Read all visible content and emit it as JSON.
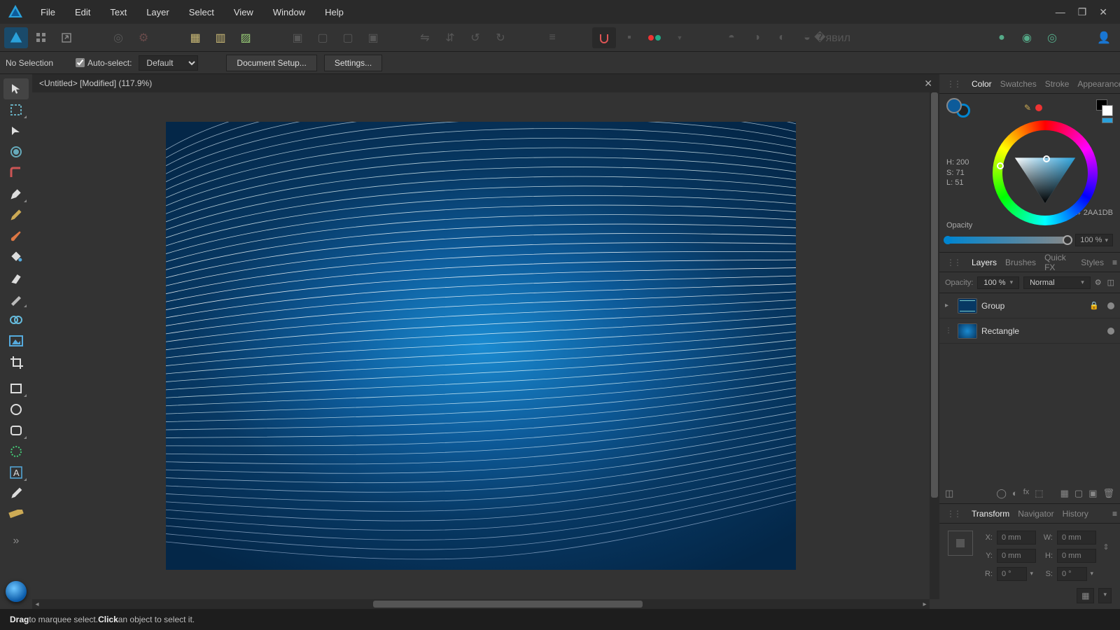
{
  "menu": {
    "items": [
      "File",
      "Edit",
      "Text",
      "Layer",
      "Select",
      "View",
      "Window",
      "Help"
    ]
  },
  "contextbar": {
    "selection_state": "No Selection",
    "autoselect_label": "Auto-select:",
    "autoselect_mode": "Default",
    "doc_setup": "Document Setup...",
    "settings": "Settings..."
  },
  "document": {
    "tab_title": "<Untitled> [Modified] (117.9%)"
  },
  "panels": {
    "top_tabs": [
      "Color",
      "Swatches",
      "Stroke",
      "Appearance"
    ],
    "mid_tabs": [
      "Layers",
      "Brushes",
      "Quick FX",
      "Styles"
    ],
    "bot_tabs": [
      "Transform",
      "Navigator",
      "History"
    ]
  },
  "color": {
    "h_label": "H: 200",
    "s_label": "S: 71",
    "l_label": "L: 51",
    "hex_prefix": "#",
    "hex": "2AA1DB",
    "opacity_label": "Opacity",
    "opacity_value": "100 %"
  },
  "layers": {
    "opacity_label": "Opacity:",
    "opacity_value": "100 %",
    "blend_mode": "Normal",
    "rows": [
      {
        "name": "Group",
        "expandable": true,
        "locked": true
      },
      {
        "name": "Rectangle",
        "expandable": false,
        "locked": false
      }
    ]
  },
  "transform": {
    "x_label": "X:",
    "x": "0 mm",
    "y_label": "Y:",
    "y": "0 mm",
    "w_label": "W:",
    "w": "0 mm",
    "h_label": "H:",
    "h": "0 mm",
    "r_label": "R:",
    "r": "0 °",
    "s_label": "S:",
    "s": "0 °"
  },
  "status": {
    "drag": "Drag",
    "drag_text": " to marquee select. ",
    "click": "Click",
    "click_text": " an object to select it."
  }
}
